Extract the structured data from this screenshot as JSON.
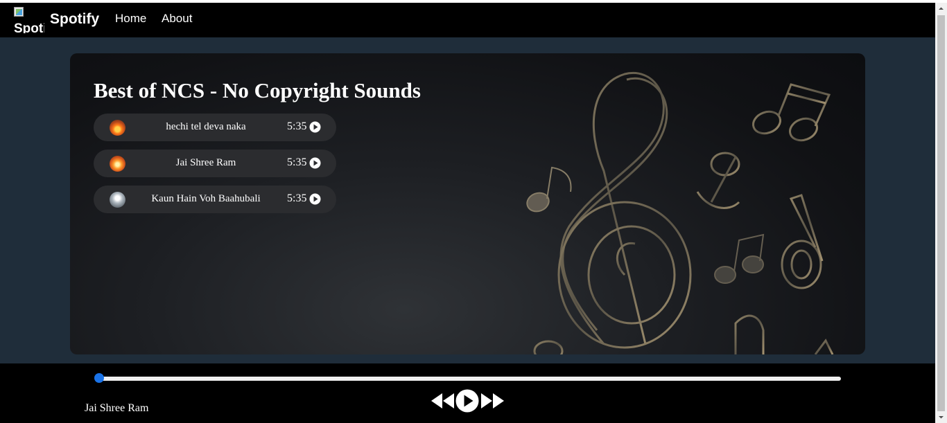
{
  "navbar": {
    "logo_alt": "Spotify",
    "brand": "Spotify",
    "links": [
      "Home",
      "About"
    ]
  },
  "playlist": {
    "title": "Best of NCS - No Copyright Sounds",
    "songs": [
      {
        "name": "hechi tel deva naka",
        "duration": "5:35",
        "thumb": "fire-image"
      },
      {
        "name": "Jai Shree Ram",
        "duration": "5:35",
        "thumb": "fire-image"
      },
      {
        "name": "Kaun Hain Voh Baahubali",
        "duration": "5:35",
        "thumb": "portrait-image"
      }
    ]
  },
  "player": {
    "now_playing": "Jai Shree Ram",
    "progress": 0.0,
    "controls": [
      "previous-icon",
      "play-icon",
      "next-icon"
    ]
  },
  "colors": {
    "navbar_bg": "#000000",
    "page_bg": "#1f2d3a",
    "song_item_bg": "#2b2c2f",
    "progress_accent": "#1a73e8",
    "track": "#efefef"
  }
}
